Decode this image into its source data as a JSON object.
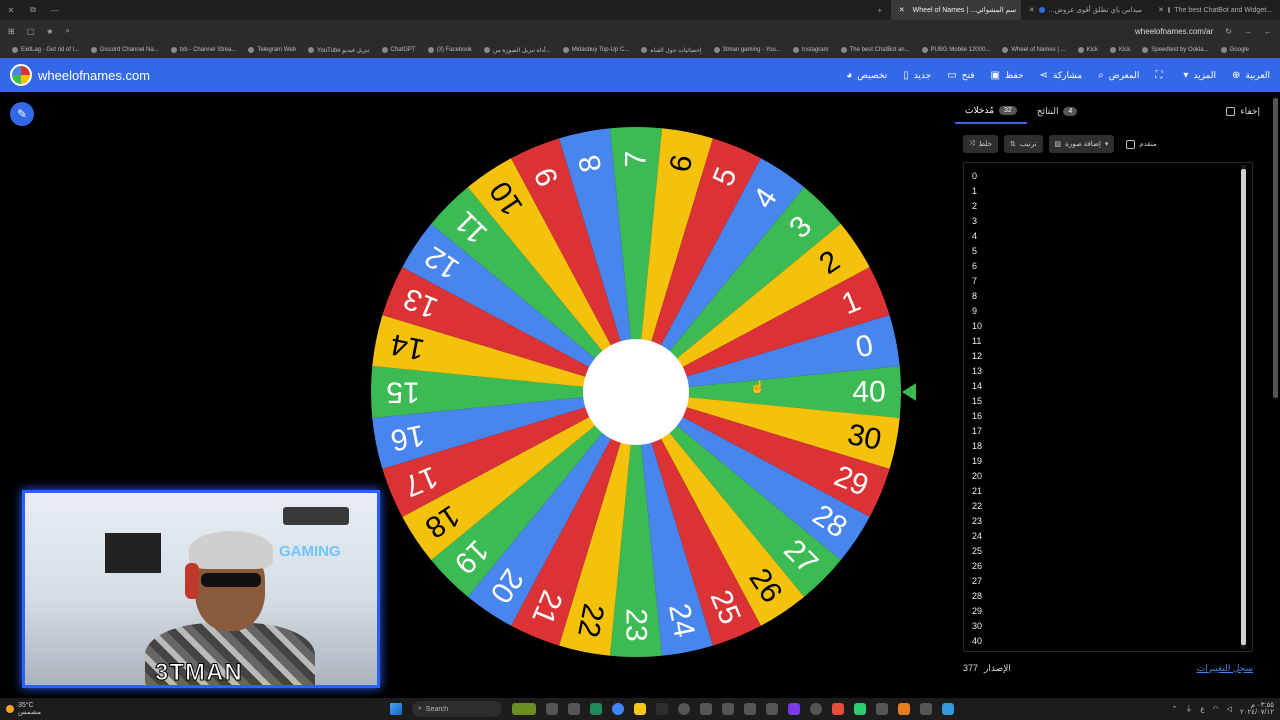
{
  "browser": {
    "tabs": [
      {
        "label": "Wheel of Names | ...سم المشوائي",
        "active": true,
        "color": "#3369e8"
      },
      {
        "label": "...ميداس باي تطلق أقوى عروض",
        "active": false,
        "color": "#3369e8"
      },
      {
        "label": "The best ChatBot and Widget...",
        "active": false,
        "color": "#888888"
      }
    ],
    "url": "wheelofnames.com/ar",
    "bookmarks": [
      "ExitLag - Get rid of l...",
      "Discord Channel Na...",
      "txb - Channel Strea...",
      "Telegram Web",
      "YouTube تنزيل فيديو",
      "ChatGPT",
      "(3) Facebook",
      "أداة تنزيل الصورة من...",
      "Midasbuy Top-Up C...",
      "إحصائيات حول القناة",
      "3tman gaming - You...",
      "Instagram",
      "The best ChatBot an...",
      "PUBG Mobile 12000...",
      "Wheel of Names | ...",
      "Kick",
      "Kick",
      "Speedtest by Ookla...",
      "Google"
    ]
  },
  "app": {
    "site_name": "wheelofnames.com",
    "menu": [
      {
        "label": "تخصيص",
        "icon": "palette-icon",
        "glyph": "◕"
      },
      {
        "label": "جديد",
        "icon": "new-file-icon",
        "glyph": "▯"
      },
      {
        "label": "فتح",
        "icon": "folder-icon",
        "glyph": "▭"
      },
      {
        "label": "حفظ",
        "icon": "save-icon",
        "glyph": "▣"
      },
      {
        "label": "مشاركة",
        "icon": "share-icon",
        "glyph": "⋖"
      },
      {
        "label": "المعرض",
        "icon": "search-icon",
        "glyph": "⌕"
      },
      {
        "label": "",
        "icon": "fullscreen-icon",
        "glyph": "⛶"
      },
      {
        "label": "المزيد",
        "icon": "chevron-down-icon",
        "glyph": "▾"
      },
      {
        "label": "العربية",
        "icon": "globe-icon",
        "glyph": "⊕"
      }
    ],
    "edit_icon": "✎"
  },
  "wheel": {
    "labels": [
      "40",
      "30",
      "29",
      "28",
      "27",
      "26",
      "25",
      "24",
      "23",
      "22",
      "21",
      "20",
      "19",
      "18",
      "17",
      "16",
      "15",
      "14",
      "13",
      "12",
      "11",
      "10",
      "9",
      "8",
      "7",
      "6",
      "5",
      "4",
      "3",
      "2",
      "1",
      "0"
    ],
    "colors": [
      "#3cba54",
      "#f4c20d",
      "#db3236",
      "#4885ed"
    ],
    "pointer_color": "#3cba54"
  },
  "panel": {
    "tabs": [
      {
        "label": "مُدخلات",
        "count": "32",
        "active": true
      },
      {
        "label": "النتائج",
        "count": "4",
        "active": false
      }
    ],
    "hide_label": "إخفاء",
    "toolbar": {
      "shuffle": "خلط",
      "sort": "ترتيب",
      "add_image": "إضافة صورة",
      "advanced": "متقدم"
    },
    "entries": [
      "0",
      "1",
      "2",
      "3",
      "4",
      "5",
      "6",
      "7",
      "8",
      "9",
      "10",
      "11",
      "12",
      "13",
      "14",
      "15",
      "16",
      "17",
      "18",
      "19",
      "20",
      "21",
      "22",
      "23",
      "24",
      "25",
      "26",
      "27",
      "28",
      "29",
      "30",
      "40"
    ],
    "version_label": "الإصدار",
    "version_number": "377",
    "changelog": "سجل التغييرات"
  },
  "webcam": {
    "tag": "GAMING",
    "name": "3TMAN"
  },
  "taskbar": {
    "weather": "35°C",
    "weather_sub": "مشمس",
    "search": "Search",
    "time": "٠٣:٥٥ م",
    "date": "٢٠٢٤/٠٧/١٢"
  }
}
